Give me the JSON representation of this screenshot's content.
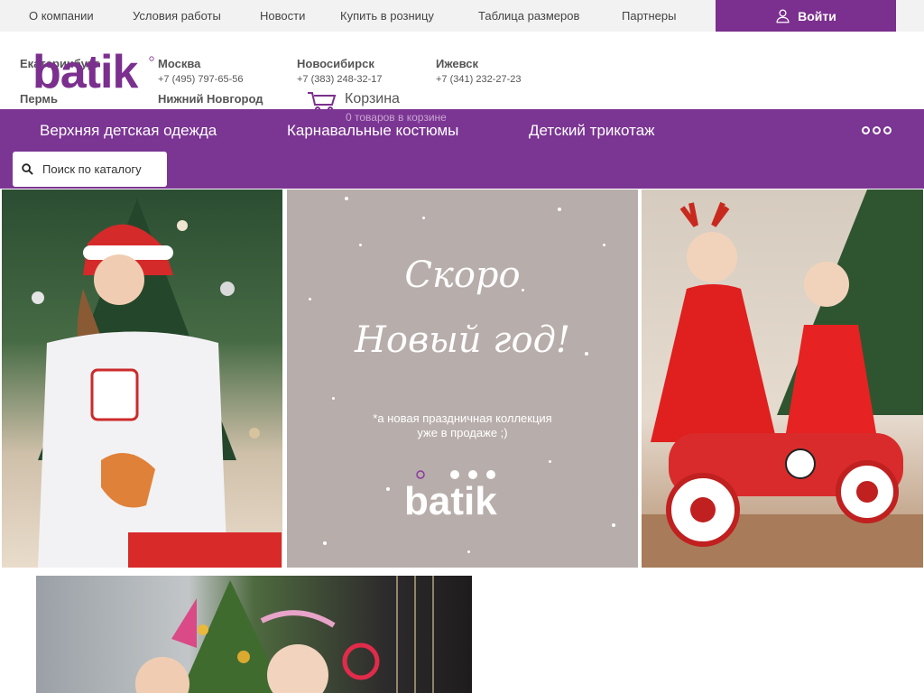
{
  "topnav": {
    "links": [
      "О компании",
      "Условия работы",
      "Новости",
      "Купить в розницу",
      "Таблица размеров",
      "Партнеры"
    ],
    "login_label": "Войти"
  },
  "header": {
    "logo_text": "batik",
    "logo_overlap_text": "Екатеринбург",
    "cities": [
      {
        "name": "Москва",
        "phone": "+7 (495) 797-65-56"
      },
      {
        "name": "Новосибирск",
        "phone": "+7 (383) 248-32-17"
      },
      {
        "name": "Ижевск",
        "phone": "+7 (341) 232-27-23"
      },
      {
        "name": "Пермь",
        "phone": ""
      },
      {
        "name": "Нижний Новгород",
        "phone": ""
      }
    ],
    "cart_label": "Корзина",
    "cart_sub": "0 товаров в корзине"
  },
  "menu": {
    "items": [
      "Верхняя детская одежда",
      "Карнавальные костюмы",
      "Детский трикотаж"
    ],
    "search_placeholder": "Поиск по каталогу"
  },
  "banner": {
    "headline_line1": "Скоро",
    "headline_line2": "Новый год!",
    "note_line1": "*а новая праздничная коллекция",
    "note_line2": "уже в продаже ;)",
    "brand_logo_text": "batik"
  },
  "colors": {
    "brand_purple": "#7b3593",
    "login_purple": "#7b2f8e",
    "promo_gray": "#b7adaa"
  }
}
